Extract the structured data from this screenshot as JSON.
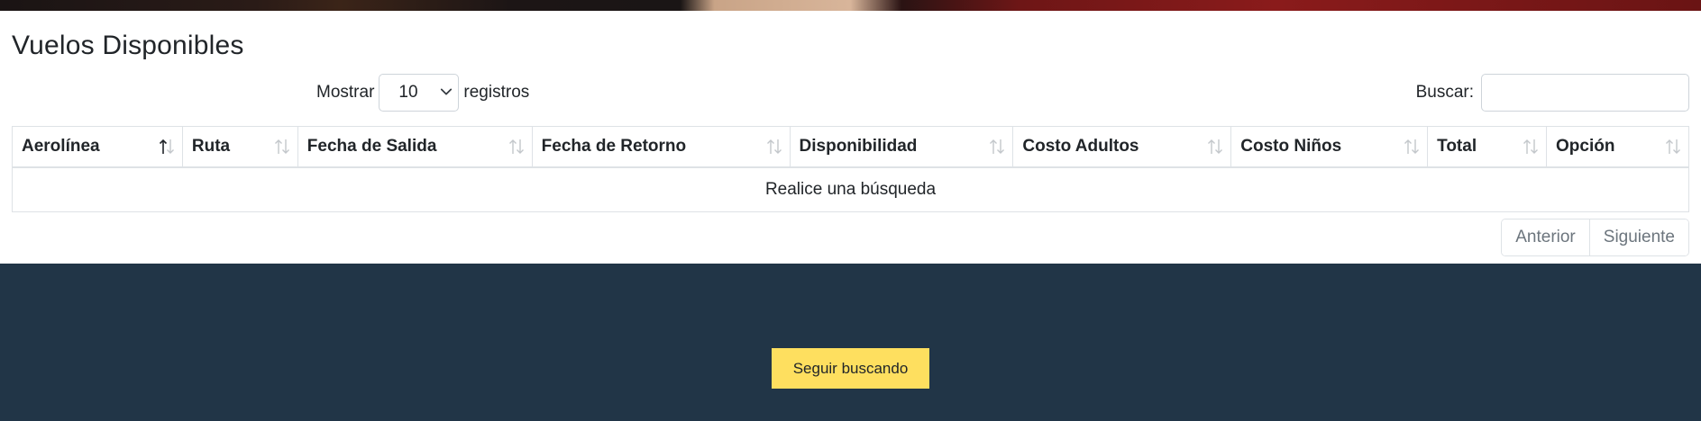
{
  "page_title": "Vuelos Disponibles",
  "length_control": {
    "prefix": "Mostrar",
    "selected": "10",
    "suffix": "registros"
  },
  "search": {
    "label": "Buscar:",
    "value": "",
    "placeholder": ""
  },
  "table": {
    "columns": [
      {
        "label": "Aerolínea",
        "sort": "asc"
      },
      {
        "label": "Ruta",
        "sort": "none"
      },
      {
        "label": "Fecha de Salida",
        "sort": "none"
      },
      {
        "label": "Fecha de Retorno",
        "sort": "none"
      },
      {
        "label": "Disponibilidad",
        "sort": "none"
      },
      {
        "label": "Costo Adultos",
        "sort": "none"
      },
      {
        "label": "Costo Niños",
        "sort": "none"
      },
      {
        "label": "Total",
        "sort": "none"
      },
      {
        "label": "Opción",
        "sort": "none"
      }
    ],
    "empty_message": "Realice una búsqueda"
  },
  "pagination": {
    "previous": "Anterior",
    "next": "Siguiente"
  },
  "footer": {
    "cta_label": "Seguir buscando"
  },
  "colors": {
    "footer_bg": "#213547",
    "cta_bg": "#fedf5f",
    "border": "#dee2e6"
  },
  "icons": {
    "sort": "sort-arrows-icon",
    "select_chevron": "chevron-down-icon"
  }
}
